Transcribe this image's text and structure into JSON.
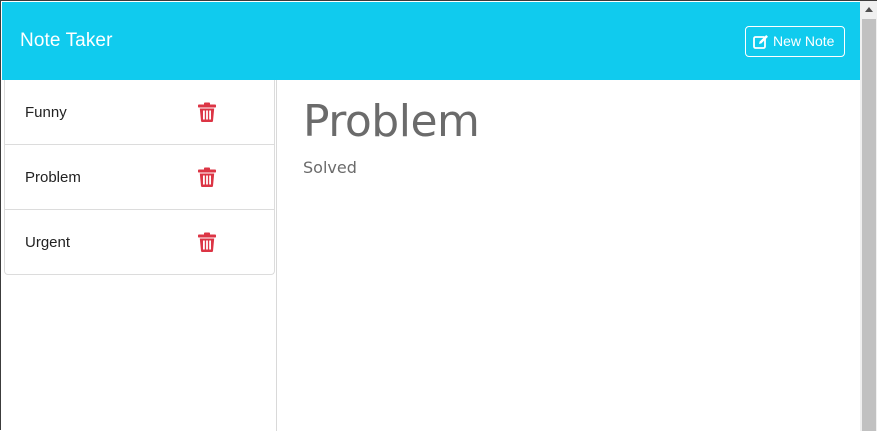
{
  "app": {
    "title": "Note Taker",
    "new_note_label": "New Note",
    "accent_color": "#10cbee",
    "delete_color": "#dc3545"
  },
  "sidebar": {
    "notes": [
      {
        "title": "Funny"
      },
      {
        "title": "Problem"
      },
      {
        "title": "Urgent"
      }
    ]
  },
  "main": {
    "note_title": "Problem",
    "note_text": "Solved"
  },
  "icons": {
    "new_note": "pen-to-square-icon",
    "delete": "trash-icon",
    "scroll_up": "chevron-up-icon"
  }
}
